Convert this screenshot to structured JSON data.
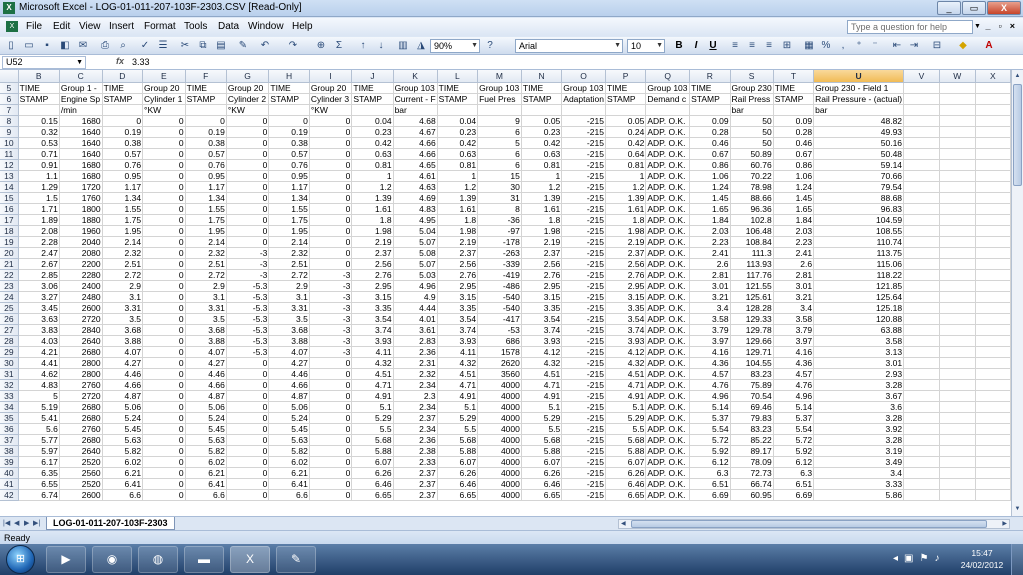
{
  "window": {
    "title": "Microsoft Excel - LOG-01-011-207-103F-2303.CSV  [Read-Only]",
    "app_icon": "excel-icon",
    "minimize": "_",
    "restore": "▭",
    "close": "X"
  },
  "menu": {
    "items": [
      "File",
      "Edit",
      "View",
      "Insert",
      "Format",
      "Tools",
      "Data",
      "Window",
      "Help"
    ],
    "help_placeholder": "Type a question for help"
  },
  "toolbar": {
    "zoom": "90%",
    "font": "Arial",
    "font_size": "10",
    "bold": "B",
    "italic": "I",
    "underline": "U"
  },
  "formula_bar": {
    "cell_ref": "U52",
    "fx": "fx",
    "value": "3.33"
  },
  "columns": [
    "B",
    "C",
    "D",
    "E",
    "F",
    "G",
    "H",
    "I",
    "J",
    "K",
    "L",
    "M",
    "N",
    "O",
    "P",
    "Q",
    "R",
    "S",
    "T",
    "U",
    "V",
    "W",
    "X"
  ],
  "active_column": "U",
  "header_rows": [
    {
      "row": "5",
      "cells": [
        "TIME",
        "Group 1 -",
        "TIME",
        "Group 20",
        "TIME",
        "Group 20",
        "TIME",
        "Group 20",
        "TIME",
        "Group 103",
        "TIME",
        "Group 103",
        "TIME",
        "Group 103",
        "TIME",
        "Group 103",
        "TIME",
        "Group 230",
        "TIME",
        "Group 230 - Field 1",
        "",
        "",
        ""
      ]
    },
    {
      "row": "6",
      "cells": [
        "STAMP",
        "Engine Sp",
        "STAMP",
        "Cylinder 1",
        "STAMP",
        "Cylinder 2",
        "STAMP",
        "Cylinder 3",
        "STAMP",
        "Current - F",
        "STAMP",
        "Fuel Pres",
        "STAMP",
        "Adaptation",
        "STAMP",
        "Demand c",
        "STAMP",
        "Rail Press",
        "STAMP",
        "Rail Pressure - (actual)",
        "",
        "",
        ""
      ]
    },
    {
      "row": "7",
      "cells": [
        "",
        "/min",
        "",
        "°KW",
        "",
        "°KW",
        "",
        "°KW",
        "",
        "bar",
        "",
        "",
        "",
        "",
        "",
        "",
        "",
        "bar",
        "",
        "bar",
        "",
        "",
        ""
      ]
    }
  ],
  "rows": [
    [
      "8",
      "0.15",
      "1680",
      "0",
      "0",
      "0",
      "0",
      "0",
      "0",
      "0.04",
      "4.68",
      "0.04",
      "9",
      "0.05",
      "-215",
      "0.05",
      "ADP. O.K.",
      "0.09",
      "50",
      "0.09",
      "48.82"
    ],
    [
      "9",
      "0.32",
      "1640",
      "0.19",
      "0",
      "0.19",
      "0",
      "0.19",
      "0",
      "0.23",
      "4.67",
      "0.23",
      "6",
      "0.23",
      "-215",
      "0.24",
      "ADP. O.K.",
      "0.28",
      "50",
      "0.28",
      "49.93"
    ],
    [
      "10",
      "0.53",
      "1640",
      "0.38",
      "0",
      "0.38",
      "0",
      "0.38",
      "0",
      "0.42",
      "4.66",
      "0.42",
      "5",
      "0.42",
      "-215",
      "0.42",
      "ADP. O.K.",
      "0.46",
      "50",
      "0.46",
      "50.16"
    ],
    [
      "11",
      "0.71",
      "1640",
      "0.57",
      "0",
      "0.57",
      "0",
      "0.57",
      "0",
      "0.63",
      "4.66",
      "0.63",
      "6",
      "0.63",
      "-215",
      "0.64",
      "ADP. O.K.",
      "0.67",
      "50.89",
      "0.67",
      "50.48"
    ],
    [
      "12",
      "0.91",
      "1680",
      "0.76",
      "0",
      "0.76",
      "0",
      "0.76",
      "0",
      "0.81",
      "4.65",
      "0.81",
      "6",
      "0.81",
      "-215",
      "0.81",
      "ADP. O.K.",
      "0.86",
      "60.76",
      "0.86",
      "59.14"
    ],
    [
      "13",
      "1.1",
      "1680",
      "0.95",
      "0",
      "0.95",
      "0",
      "0.95",
      "0",
      "1",
      "4.61",
      "1",
      "15",
      "1",
      "-215",
      "1",
      "ADP. O.K.",
      "1.06",
      "70.22",
      "1.06",
      "70.66"
    ],
    [
      "14",
      "1.29",
      "1720",
      "1.17",
      "0",
      "1.17",
      "0",
      "1.17",
      "0",
      "1.2",
      "4.63",
      "1.2",
      "30",
      "1.2",
      "-215",
      "1.2",
      "ADP. O.K.",
      "1.24",
      "78.98",
      "1.24",
      "79.54"
    ],
    [
      "15",
      "1.5",
      "1760",
      "1.34",
      "0",
      "1.34",
      "0",
      "1.34",
      "0",
      "1.39",
      "4.69",
      "1.39",
      "31",
      "1.39",
      "-215",
      "1.39",
      "ADP. O.K.",
      "1.45",
      "88.66",
      "1.45",
      "88.68"
    ],
    [
      "16",
      "1.71",
      "1800",
      "1.55",
      "0",
      "1.55",
      "0",
      "1.55",
      "0",
      "1.61",
      "4.83",
      "1.61",
      "8",
      "1.61",
      "-215",
      "1.61",
      "ADP. O.K.",
      "1.65",
      "96.36",
      "1.65",
      "96.83"
    ],
    [
      "17",
      "1.89",
      "1880",
      "1.75",
      "0",
      "1.75",
      "0",
      "1.75",
      "0",
      "1.8",
      "4.95",
      "1.8",
      "-36",
      "1.8",
      "-215",
      "1.8",
      "ADP. O.K.",
      "1.84",
      "102.8",
      "1.84",
      "104.59"
    ],
    [
      "18",
      "2.08",
      "1960",
      "1.95",
      "0",
      "1.95",
      "0",
      "1.95",
      "0",
      "1.98",
      "5.04",
      "1.98",
      "-97",
      "1.98",
      "-215",
      "1.98",
      "ADP. O.K.",
      "2.03",
      "106.48",
      "2.03",
      "108.55"
    ],
    [
      "19",
      "2.28",
      "2040",
      "2.14",
      "0",
      "2.14",
      "0",
      "2.14",
      "0",
      "2.19",
      "5.07",
      "2.19",
      "-178",
      "2.19",
      "-215",
      "2.19",
      "ADP. O.K.",
      "2.23",
      "108.84",
      "2.23",
      "110.74"
    ],
    [
      "20",
      "2.47",
      "2080",
      "2.32",
      "0",
      "2.32",
      "-3",
      "2.32",
      "0",
      "2.37",
      "5.08",
      "2.37",
      "-263",
      "2.37",
      "-215",
      "2.37",
      "ADP. O.K.",
      "2.41",
      "111.3",
      "2.41",
      "113.75"
    ],
    [
      "21",
      "2.67",
      "2200",
      "2.51",
      "0",
      "2.51",
      "-3",
      "2.51",
      "0",
      "2.56",
      "5.07",
      "2.56",
      "-339",
      "2.56",
      "-215",
      "2.56",
      "ADP. O.K.",
      "2.6",
      "113.93",
      "2.6",
      "115.06"
    ],
    [
      "22",
      "2.85",
      "2280",
      "2.72",
      "0",
      "2.72",
      "-3",
      "2.72",
      "-3",
      "2.76",
      "5.03",
      "2.76",
      "-419",
      "2.76",
      "-215",
      "2.76",
      "ADP. O.K.",
      "2.81",
      "117.76",
      "2.81",
      "118.22"
    ],
    [
      "23",
      "3.06",
      "2400",
      "2.9",
      "0",
      "2.9",
      "-5.3",
      "2.9",
      "-3",
      "2.95",
      "4.96",
      "2.95",
      "-486",
      "2.95",
      "-215",
      "2.95",
      "ADP. O.K.",
      "3.01",
      "121.55",
      "3.01",
      "121.85"
    ],
    [
      "24",
      "3.27",
      "2480",
      "3.1",
      "0",
      "3.1",
      "-5.3",
      "3.1",
      "-3",
      "3.15",
      "4.9",
      "3.15",
      "-540",
      "3.15",
      "-215",
      "3.15",
      "ADP. O.K.",
      "3.21",
      "125.61",
      "3.21",
      "125.64"
    ],
    [
      "25",
      "3.45",
      "2600",
      "3.31",
      "0",
      "3.31",
      "-5.3",
      "3.31",
      "-3",
      "3.35",
      "4.44",
      "3.35",
      "-540",
      "3.35",
      "-215",
      "3.35",
      "ADP. O.K.",
      "3.4",
      "128.28",
      "3.4",
      "125.18"
    ],
    [
      "26",
      "3.63",
      "2720",
      "3.5",
      "0",
      "3.5",
      "-5.3",
      "3.5",
      "-3",
      "3.54",
      "4.01",
      "3.54",
      "-417",
      "3.54",
      "-215",
      "3.54",
      "ADP. O.K.",
      "3.58",
      "129.33",
      "3.58",
      "120.88"
    ],
    [
      "27",
      "3.83",
      "2840",
      "3.68",
      "0",
      "3.68",
      "-5.3",
      "3.68",
      "-3",
      "3.74",
      "3.61",
      "3.74",
      "-53",
      "3.74",
      "-215",
      "3.74",
      "ADP. O.K.",
      "3.79",
      "129.78",
      "3.79",
      "63.88"
    ],
    [
      "28",
      "4.03",
      "2640",
      "3.88",
      "0",
      "3.88",
      "-5.3",
      "3.88",
      "-3",
      "3.93",
      "2.83",
      "3.93",
      "686",
      "3.93",
      "-215",
      "3.93",
      "ADP. O.K.",
      "3.97",
      "129.66",
      "3.97",
      "3.58"
    ],
    [
      "29",
      "4.21",
      "2680",
      "4.07",
      "0",
      "4.07",
      "-5.3",
      "4.07",
      "-3",
      "4.11",
      "2.36",
      "4.11",
      "1578",
      "4.12",
      "-215",
      "4.12",
      "ADP. O.K.",
      "4.16",
      "129.71",
      "4.16",
      "3.13"
    ],
    [
      "30",
      "4.41",
      "2800",
      "4.27",
      "0",
      "4.27",
      "0",
      "4.27",
      "0",
      "4.32",
      "2.31",
      "4.32",
      "2620",
      "4.32",
      "-215",
      "4.32",
      "ADP. O.K.",
      "4.36",
      "104.55",
      "4.36",
      "3.01"
    ],
    [
      "31",
      "4.62",
      "2800",
      "4.46",
      "0",
      "4.46",
      "0",
      "4.46",
      "0",
      "4.51",
      "2.32",
      "4.51",
      "3560",
      "4.51",
      "-215",
      "4.51",
      "ADP. O.K.",
      "4.57",
      "83.23",
      "4.57",
      "2.93"
    ],
    [
      "32",
      "4.83",
      "2760",
      "4.66",
      "0",
      "4.66",
      "0",
      "4.66",
      "0",
      "4.71",
      "2.34",
      "4.71",
      "4000",
      "4.71",
      "-215",
      "4.71",
      "ADP. O.K.",
      "4.76",
      "75.89",
      "4.76",
      "3.28"
    ],
    [
      "33",
      "5",
      "2720",
      "4.87",
      "0",
      "4.87",
      "0",
      "4.87",
      "0",
      "4.91",
      "2.3",
      "4.91",
      "4000",
      "4.91",
      "-215",
      "4.91",
      "ADP. O.K.",
      "4.96",
      "70.54",
      "4.96",
      "3.67"
    ],
    [
      "34",
      "5.19",
      "2680",
      "5.06",
      "0",
      "5.06",
      "0",
      "5.06",
      "0",
      "5.1",
      "2.34",
      "5.1",
      "4000",
      "5.1",
      "-215",
      "5.1",
      "ADP. O.K.",
      "5.14",
      "69.46",
      "5.14",
      "3.6"
    ],
    [
      "35",
      "5.41",
      "2680",
      "5.24",
      "0",
      "5.24",
      "0",
      "5.24",
      "0",
      "5.29",
      "2.37",
      "5.29",
      "4000",
      "5.29",
      "-215",
      "5.29",
      "ADP. O.K.",
      "5.37",
      "79.83",
      "5.37",
      "3.28"
    ],
    [
      "36",
      "5.6",
      "2760",
      "5.45",
      "0",
      "5.45",
      "0",
      "5.45",
      "0",
      "5.5",
      "2.34",
      "5.5",
      "4000",
      "5.5",
      "-215",
      "5.5",
      "ADP. O.K.",
      "5.54",
      "83.23",
      "5.54",
      "3.92"
    ],
    [
      "37",
      "5.77",
      "2680",
      "5.63",
      "0",
      "5.63",
      "0",
      "5.63",
      "0",
      "5.68",
      "2.36",
      "5.68",
      "4000",
      "5.68",
      "-215",
      "5.68",
      "ADP. O.K.",
      "5.72",
      "85.22",
      "5.72",
      "3.28"
    ],
    [
      "38",
      "5.97",
      "2640",
      "5.82",
      "0",
      "5.82",
      "0",
      "5.82",
      "0",
      "5.88",
      "2.38",
      "5.88",
      "4000",
      "5.88",
      "-215",
      "5.88",
      "ADP. O.K.",
      "5.92",
      "89.17",
      "5.92",
      "3.19"
    ],
    [
      "39",
      "6.17",
      "2520",
      "6.02",
      "0",
      "6.02",
      "0",
      "6.02",
      "0",
      "6.07",
      "2.33",
      "6.07",
      "4000",
      "6.07",
      "-215",
      "6.07",
      "ADP. O.K.",
      "6.12",
      "78.09",
      "6.12",
      "3.49"
    ],
    [
      "40",
      "6.35",
      "2560",
      "6.21",
      "0",
      "6.21",
      "0",
      "6.21",
      "0",
      "6.26",
      "2.37",
      "6.26",
      "4000",
      "6.26",
      "-215",
      "6.26",
      "ADP. O.K.",
      "6.3",
      "72.73",
      "6.3",
      "3.4"
    ],
    [
      "41",
      "6.55",
      "2520",
      "6.41",
      "0",
      "6.41",
      "0",
      "6.41",
      "0",
      "6.46",
      "2.37",
      "6.46",
      "4000",
      "6.46",
      "-215",
      "6.46",
      "ADP. O.K.",
      "6.51",
      "66.74",
      "6.51",
      "3.33"
    ],
    [
      "42",
      "6.74",
      "2600",
      "6.6",
      "0",
      "6.6",
      "0",
      "6.6",
      "0",
      "6.65",
      "2.37",
      "6.65",
      "4000",
      "6.65",
      "-215",
      "6.65",
      "ADP. O.K.",
      "6.69",
      "60.95",
      "6.69",
      "5.86"
    ]
  ],
  "sheet": {
    "tab_name": "LOG-01-011-207-103F-2303"
  },
  "status": {
    "text": "Ready"
  },
  "taskbar": {
    "start_icon": "windows-start-icon",
    "apps": [
      "media-player-icon",
      "chrome-icon",
      "vcds-icon",
      "folder-icon",
      "excel-icon",
      "paint-icon"
    ],
    "time": "15:47",
    "date": "24/02/2012"
  }
}
